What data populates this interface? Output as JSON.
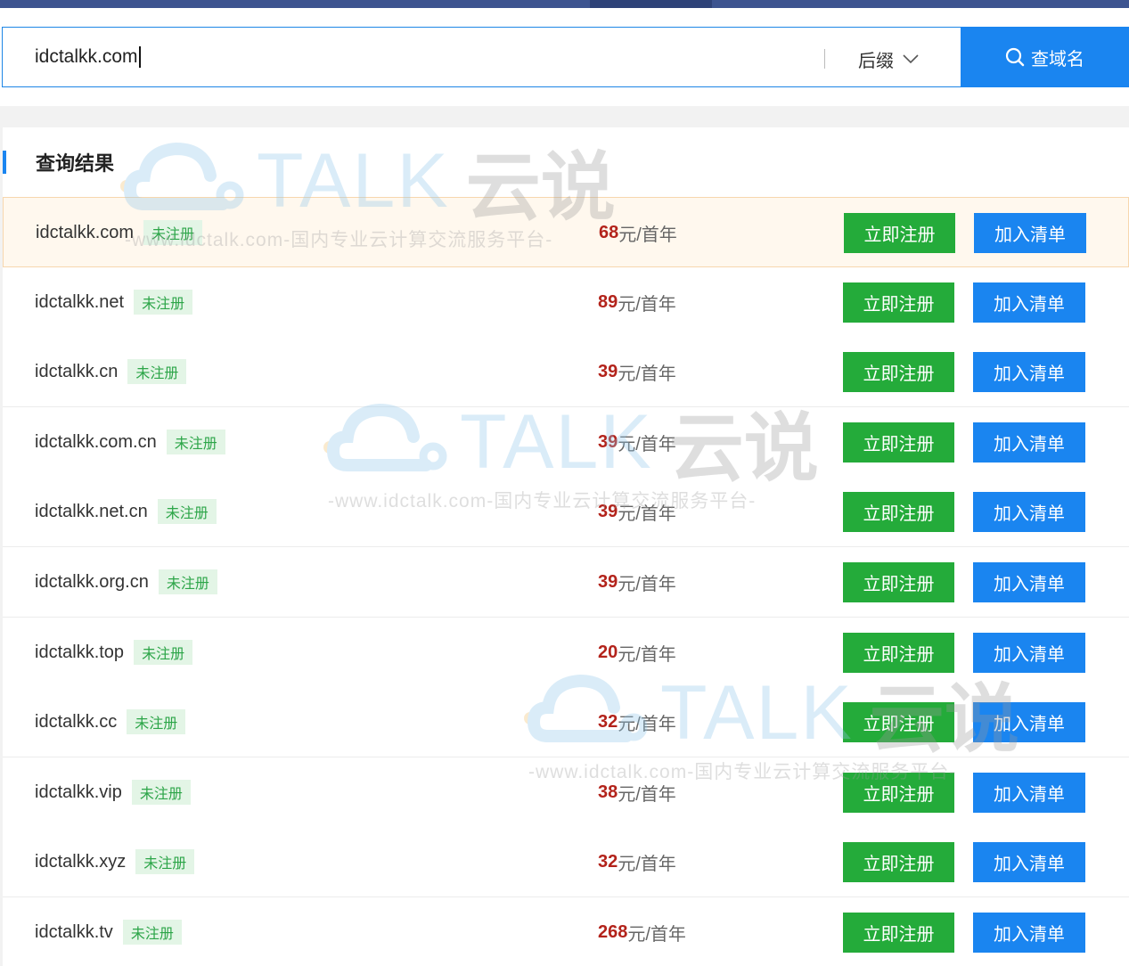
{
  "search": {
    "value": "idctalkk.com",
    "suffix_label": "后缀",
    "button_label": "查域名"
  },
  "results": {
    "title": "查询结果",
    "unit": "元/首年",
    "register_label": "立即注册",
    "add_label": "加入清单",
    "rows": [
      {
        "domain": "idctalkk.com",
        "status": "未注册",
        "price": "68"
      },
      {
        "domain": "idctalkk.net",
        "status": "未注册",
        "price": "89"
      },
      {
        "domain": "idctalkk.cn",
        "status": "未注册",
        "price": "39"
      },
      {
        "domain": "idctalkk.com.cn",
        "status": "未注册",
        "price": "39"
      },
      {
        "domain": "idctalkk.net.cn",
        "status": "未注册",
        "price": "39"
      },
      {
        "domain": "idctalkk.org.cn",
        "status": "未注册",
        "price": "39"
      },
      {
        "domain": "idctalkk.top",
        "status": "未注册",
        "price": "20"
      },
      {
        "domain": "idctalkk.cc",
        "status": "未注册",
        "price": "32"
      },
      {
        "domain": "idctalkk.vip",
        "status": "未注册",
        "price": "38"
      },
      {
        "domain": "idctalkk.xyz",
        "status": "未注册",
        "price": "32"
      },
      {
        "domain": "idctalkk.tv",
        "status": "未注册",
        "price": "268"
      }
    ]
  },
  "watermark": {
    "brand": "TALK",
    "cn": "云说",
    "sub": "-www.idctalk.com-国内专业云计算交流服务平台-"
  },
  "colors": {
    "accent_blue": "#1a85f0",
    "register_green": "#24ab3a",
    "price_red": "#b3231b",
    "badge_bg": "#e3f5e6",
    "highlight_bg": "#fff8ee"
  }
}
